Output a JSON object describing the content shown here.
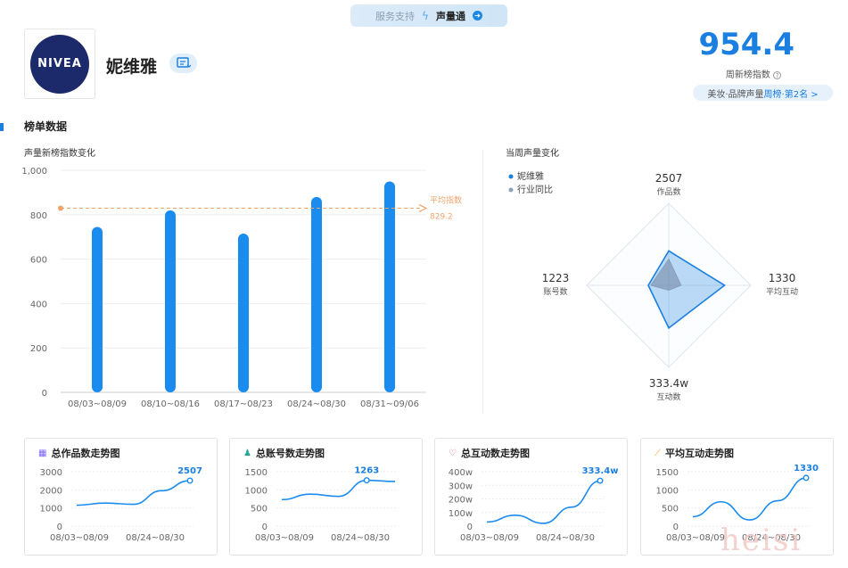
{
  "header": {
    "service_label": "服务支持",
    "service_name": "声量通",
    "brand_logo_text": "NIVEA",
    "brand_name": "妮维雅",
    "index_value": "954.4",
    "index_label": "周新榜指数",
    "rank_prefix": "美妆·品牌声量",
    "rank_highlight": "周榜·第2名 >"
  },
  "section_title": "榜单数据",
  "bar_chart_title": "声量新榜指数变化",
  "radar_title": "当周声量变化",
  "colors": {
    "accent": "#1a7fe0",
    "bar": "#1a8cf0",
    "avg": "#f0a36a",
    "radar_brand": "#1a7fe0",
    "radar_industry": "#8a9fb8"
  },
  "chart_data": [
    {
      "type": "bar",
      "title": "声量新榜指数变化",
      "categories": [
        "08/03~08/09",
        "08/10~08/16",
        "08/17~08/23",
        "08/24~08/30",
        "08/31~09/06"
      ],
      "values": [
        745,
        820,
        715,
        880,
        950
      ],
      "ylim": [
        0,
        1000
      ],
      "yticks": [
        "0",
        "200",
        "400",
        "600",
        "800",
        "1,000"
      ],
      "ytick_values": [
        0,
        200,
        400,
        600,
        800,
        1000
      ],
      "average": {
        "label": "平均指数",
        "value": 829.2,
        "value_label": "829.2"
      },
      "grid": true
    },
    {
      "type": "radar",
      "title": "当周声量变化",
      "legend": [
        "妮维雅",
        "行业同比"
      ],
      "axes": [
        {
          "name": "作品数",
          "value_label": "2507"
        },
        {
          "name": "平均互动",
          "value_label": "1330"
        },
        {
          "name": "互动数",
          "value_label": "333.4w"
        },
        {
          "name": "账号数",
          "value_label": "1223"
        }
      ],
      "series": [
        {
          "name": "妮维雅",
          "values": [
            0.42,
            0.68,
            0.52,
            0.25
          ]
        },
        {
          "name": "行业同比",
          "values": [
            0.32,
            0.15,
            0.06,
            0.22
          ]
        }
      ]
    },
    {
      "type": "line",
      "title": "总作品数走势图",
      "x_labels": [
        "08/03~08/09",
        "08/24~08/30"
      ],
      "x": [
        0,
        1,
        2,
        3,
        4
      ],
      "values": [
        1150,
        1270,
        1200,
        1950,
        2507
      ],
      "ylim": [
        0,
        3000
      ],
      "yticks": [
        "0",
        "1000",
        "2000",
        "3000"
      ],
      "ytick_values": [
        0,
        1000,
        2000,
        3000
      ],
      "end_label": "2507"
    },
    {
      "type": "line",
      "title": "总账号数走势图",
      "x_labels": [
        "08/03~08/09",
        "08/24~08/30"
      ],
      "x": [
        0,
        1,
        2,
        3,
        4
      ],
      "values": [
        730,
        880,
        820,
        1263,
        1230
      ],
      "ylim": [
        0,
        1500
      ],
      "yticks": [
        "0",
        "500",
        "1000",
        "1500"
      ],
      "ytick_values": [
        0,
        500,
        1000,
        1500
      ],
      "end_label": "1263"
    },
    {
      "type": "line",
      "title": "总互动数走势图",
      "x_labels": [
        "08/03~08/09",
        "08/24~08/30"
      ],
      "x": [
        0,
        1,
        2,
        3,
        4
      ],
      "values": [
        30,
        80,
        20,
        140,
        333.4
      ],
      "ylim": [
        0,
        400
      ],
      "yticks": [
        "0",
        "100w",
        "200w",
        "300w",
        "400w"
      ],
      "ytick_values": [
        0,
        100,
        200,
        300,
        400
      ],
      "end_label": "333.4w"
    },
    {
      "type": "line",
      "title": "平均互动走势图",
      "x_labels": [
        "08/03~08/09",
        "08/24~08/30"
      ],
      "x": [
        0,
        1,
        2,
        3,
        4
      ],
      "values": [
        260,
        670,
        170,
        700,
        1330
      ],
      "ylim": [
        0,
        1500
      ],
      "yticks": [
        "0",
        "500",
        "1000",
        "1500"
      ],
      "ytick_values": [
        0,
        500,
        1000,
        1500
      ],
      "end_label": "1330"
    }
  ],
  "watermark": "heisi"
}
